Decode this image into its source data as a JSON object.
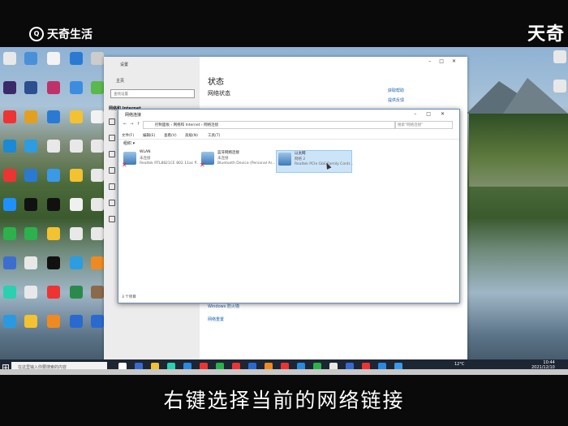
{
  "watermark": {
    "left_text": "天奇生活",
    "right_text": "天奇"
  },
  "caption": "右键选择当前的网络链接",
  "settings_window": {
    "title": "设置",
    "home": "主页",
    "search_placeholder": "查找设置",
    "section": "网络和 Internet",
    "heading": "状态",
    "subheading": "网络状态",
    "help_links": [
      "获取帮助",
      "提供反馈"
    ],
    "bottom_links": [
      "Windows 防火墙",
      "网络重置"
    ]
  },
  "network_window": {
    "title": "网络连接",
    "address_path": "控制面板 › 网络和 Internet › 网络连接",
    "search_placeholder": "搜索\"网络连接\"",
    "menu": [
      "文件(F)",
      "编辑(E)",
      "查看(V)",
      "高级(N)",
      "工具(T)"
    ],
    "organize": "组织 ▾",
    "connections": [
      {
        "name": "WLAN",
        "status": "未连接",
        "device": "Realtek RTL8821CE 802.11ac P...",
        "disabled": true,
        "selected": false
      },
      {
        "name": "蓝牙网络连接",
        "status": "未连接",
        "device": "Bluetooth Device (Personal Ar...",
        "disabled": true,
        "selected": false
      },
      {
        "name": "以太网",
        "status": "网络 2",
        "device": "Realtek PCIe GbE Family Contr...",
        "disabled": false,
        "selected": true
      }
    ],
    "status_bar": "3 个项目"
  },
  "taskbar": {
    "search_placeholder": "在这里输入你要搜索的内容",
    "weather": "12°C",
    "time": "10:44",
    "date": "2021/12/10"
  },
  "colors": {
    "link": "#1b5fb0",
    "taskbar": "#1d2633",
    "selection": "#cce4f7"
  }
}
